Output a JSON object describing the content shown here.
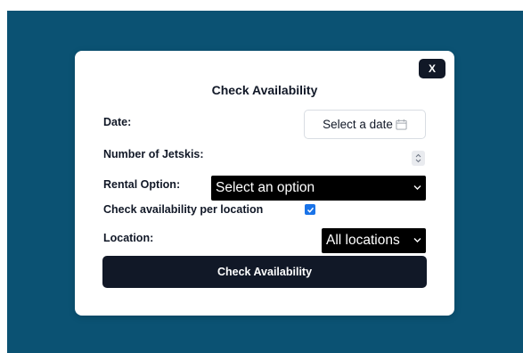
{
  "modal": {
    "close_label": "X",
    "title": "Check Availability"
  },
  "form": {
    "date_label": "Date:",
    "date_button": "Select a date",
    "jetskis_label": "Number of Jetskis:",
    "rental_label": "Rental Option:",
    "rental_selected": "Select an option",
    "per_location_label": "Check availability per location",
    "per_location_checked": true,
    "location_label": "Location:",
    "location_selected": "All locations",
    "submit_label": "Check Availability"
  },
  "colors": {
    "backdrop": "#0b5273",
    "primary_dark": "#111827",
    "checkbox": "#1a73e8"
  },
  "icons": {
    "date": "calendar-icon",
    "stepper": "stepper-arrows-icon",
    "select": "chevron-down-icon",
    "checkbox": "checkmark-icon"
  }
}
